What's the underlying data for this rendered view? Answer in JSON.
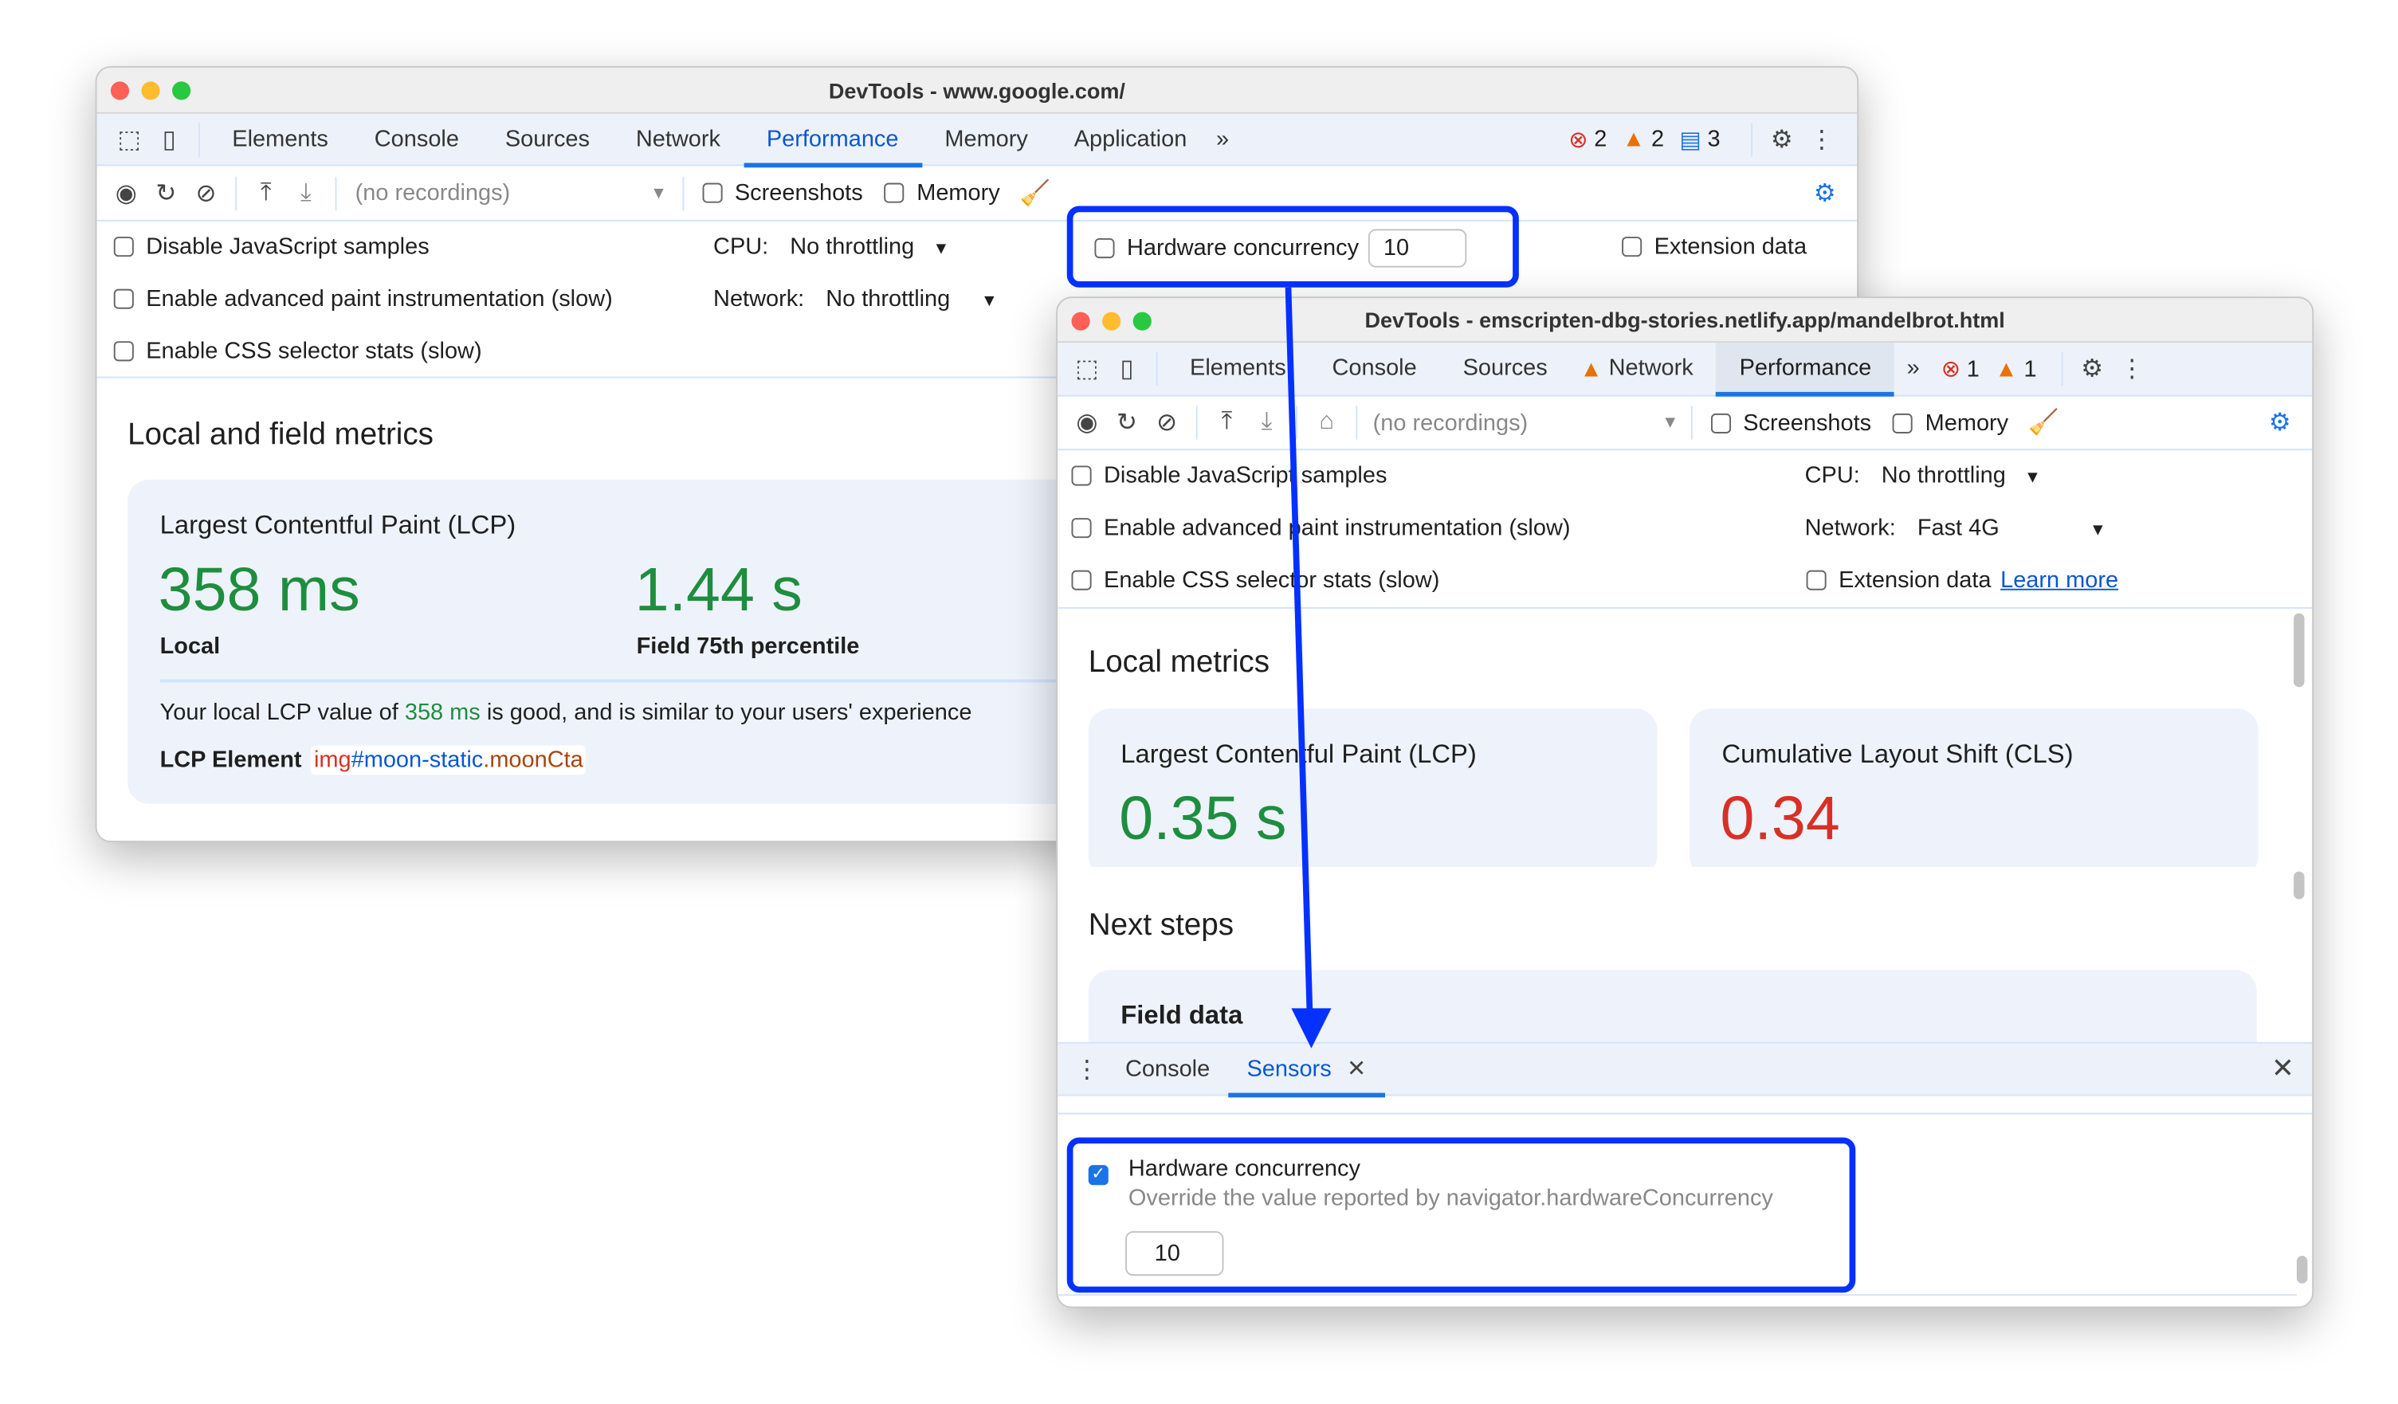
{
  "window1": {
    "title": "DevTools - www.google.com/",
    "tabs": [
      "Elements",
      "Console",
      "Sources",
      "Network",
      "Performance",
      "Memory",
      "Application"
    ],
    "active_tab": "Performance",
    "more_tabs": "»",
    "errors": "2",
    "warnings": "2",
    "messages": "3",
    "recordings": "(no recordings)",
    "screenshots": "Screenshots",
    "memory": "Memory",
    "settings": {
      "disable_js": "Disable JavaScript samples",
      "paint": "Enable advanced paint instrumentation (slow)",
      "css": "Enable CSS selector stats (slow)",
      "cpu_label": "CPU:",
      "cpu_value": "No throttling",
      "network_label": "Network:",
      "network_value": "No throttling",
      "hw_label": "Hardware concurrency",
      "hw_value": "10",
      "ext": "Extension data"
    },
    "section_title": "Local and field metrics",
    "lcp": {
      "title": "Largest Contentful Paint (LCP)",
      "local_value": "358 ms",
      "local_label": "Local",
      "field_value": "1.44 s",
      "field_label": "Field 75th percentile",
      "desc_pre": "Your local LCP value of ",
      "desc_value": "358 ms",
      "desc_post": " is good, and is similar to your users' experience",
      "element_label": "LCP Element",
      "el_tag": "img",
      "el_id": "#moon-static",
      "el_class": ".moonCta"
    }
  },
  "window2": {
    "title": "DevTools - emscripten-dbg-stories.netlify.app/mandelbrot.html",
    "tabs": [
      "Elements",
      "Console",
      "Sources",
      "Network",
      "Performance"
    ],
    "active_tab": "Performance",
    "more_tabs": "»",
    "errors": "1",
    "warnings": "1",
    "recordings": "(no recordings)",
    "screenshots": "Screenshots",
    "memory": "Memory",
    "settings": {
      "disable_js": "Disable JavaScript samples",
      "paint": "Enable advanced paint instrumentation (slow)",
      "css": "Enable CSS selector stats (slow)",
      "cpu_label": "CPU:",
      "cpu_value": "No throttling",
      "network_label": "Network:",
      "network_value": "Fast 4G",
      "ext": "Extension data",
      "learn_more": "Learn more"
    },
    "section_title": "Local metrics",
    "lcp": {
      "title": "Largest Contentful Paint (LCP)",
      "value": "0.35 s"
    },
    "cls": {
      "title": "Cumulative Layout Shift (CLS)",
      "value": "0.34"
    },
    "next_steps": "Next steps",
    "field_data": "Field data",
    "drawer": {
      "tabs": [
        "Console",
        "Sensors"
      ],
      "active": "Sensors"
    },
    "sensors": {
      "hw_label": "Hardware concurrency",
      "hw_desc": "Override the value reported by navigator.hardwareConcurrency",
      "hw_value": "10",
      "hw_checked": true
    }
  },
  "colors": {
    "accent": "#1a73e8",
    "highlight": "#0531ff",
    "good": "#1e8e3e",
    "bad": "#d93025"
  }
}
